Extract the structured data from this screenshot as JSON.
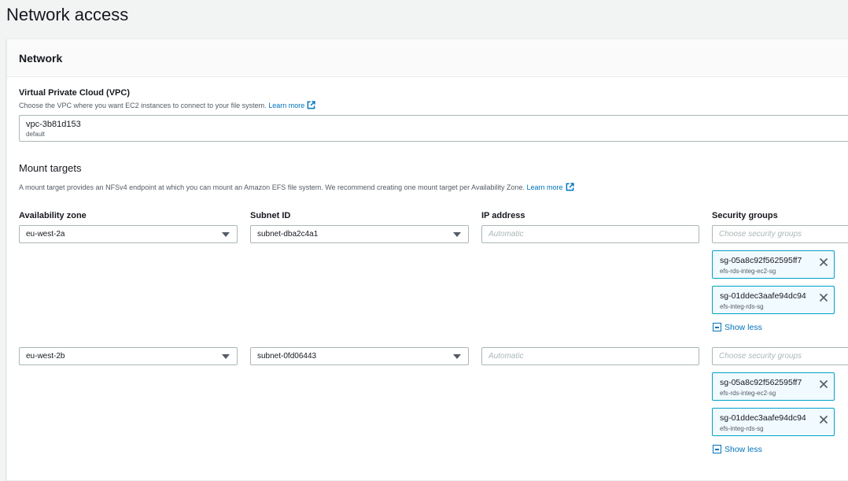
{
  "page": {
    "title": "Network access"
  },
  "network": {
    "title": "Network",
    "vpc": {
      "label": "Virtual Private Cloud (VPC)",
      "description": "Choose the VPC where you want EC2 instances to connect to your file system.",
      "learn_more": "Learn more",
      "selected_id": "vpc-3b81d153",
      "selected_name": "default"
    },
    "mount_targets": {
      "title": "Mount targets",
      "description": "A mount target provides an NFSv4 endpoint at which you can mount an Amazon EFS file system. We recommend creating one mount target per Availability Zone.",
      "learn_more": "Learn more",
      "columns": {
        "az": "Availability zone",
        "subnet": "Subnet ID",
        "ip": "IP address",
        "sg": "Security groups"
      },
      "rows": [
        {
          "az": "eu-west-2a",
          "subnet": "subnet-dba2c4a1",
          "ip_placeholder": "Automatic",
          "sg_placeholder": "Choose security groups",
          "security_groups": [
            {
              "id": "sg-05a8c92f562595ff7",
              "name": "efs-rds-integ-ec2-sg"
            },
            {
              "id": "sg-01ddec3aafe94dc94",
              "name": "efs-integ-rds-sg"
            }
          ],
          "show_less": "Show less"
        },
        {
          "az": "eu-west-2b",
          "subnet": "subnet-0fd06443",
          "ip_placeholder": "Automatic",
          "sg_placeholder": "Choose security groups",
          "security_groups": [
            {
              "id": "sg-05a8c92f562595ff7",
              "name": "efs-rds-integ-ec2-sg"
            },
            {
              "id": "sg-01ddec3aafe94dc94",
              "name": "efs-integ-rds-sg"
            }
          ],
          "show_less": "Show less"
        }
      ]
    }
  },
  "colors": {
    "link": "#0073bb",
    "token_border": "#00a1c9",
    "token_bg": "#f1faff",
    "border": "#aab7b8"
  },
  "icons": {
    "external_link": "external-link-icon",
    "dropdown": "caret-down-icon",
    "remove": "close-icon",
    "collapse": "minus-square-icon"
  }
}
